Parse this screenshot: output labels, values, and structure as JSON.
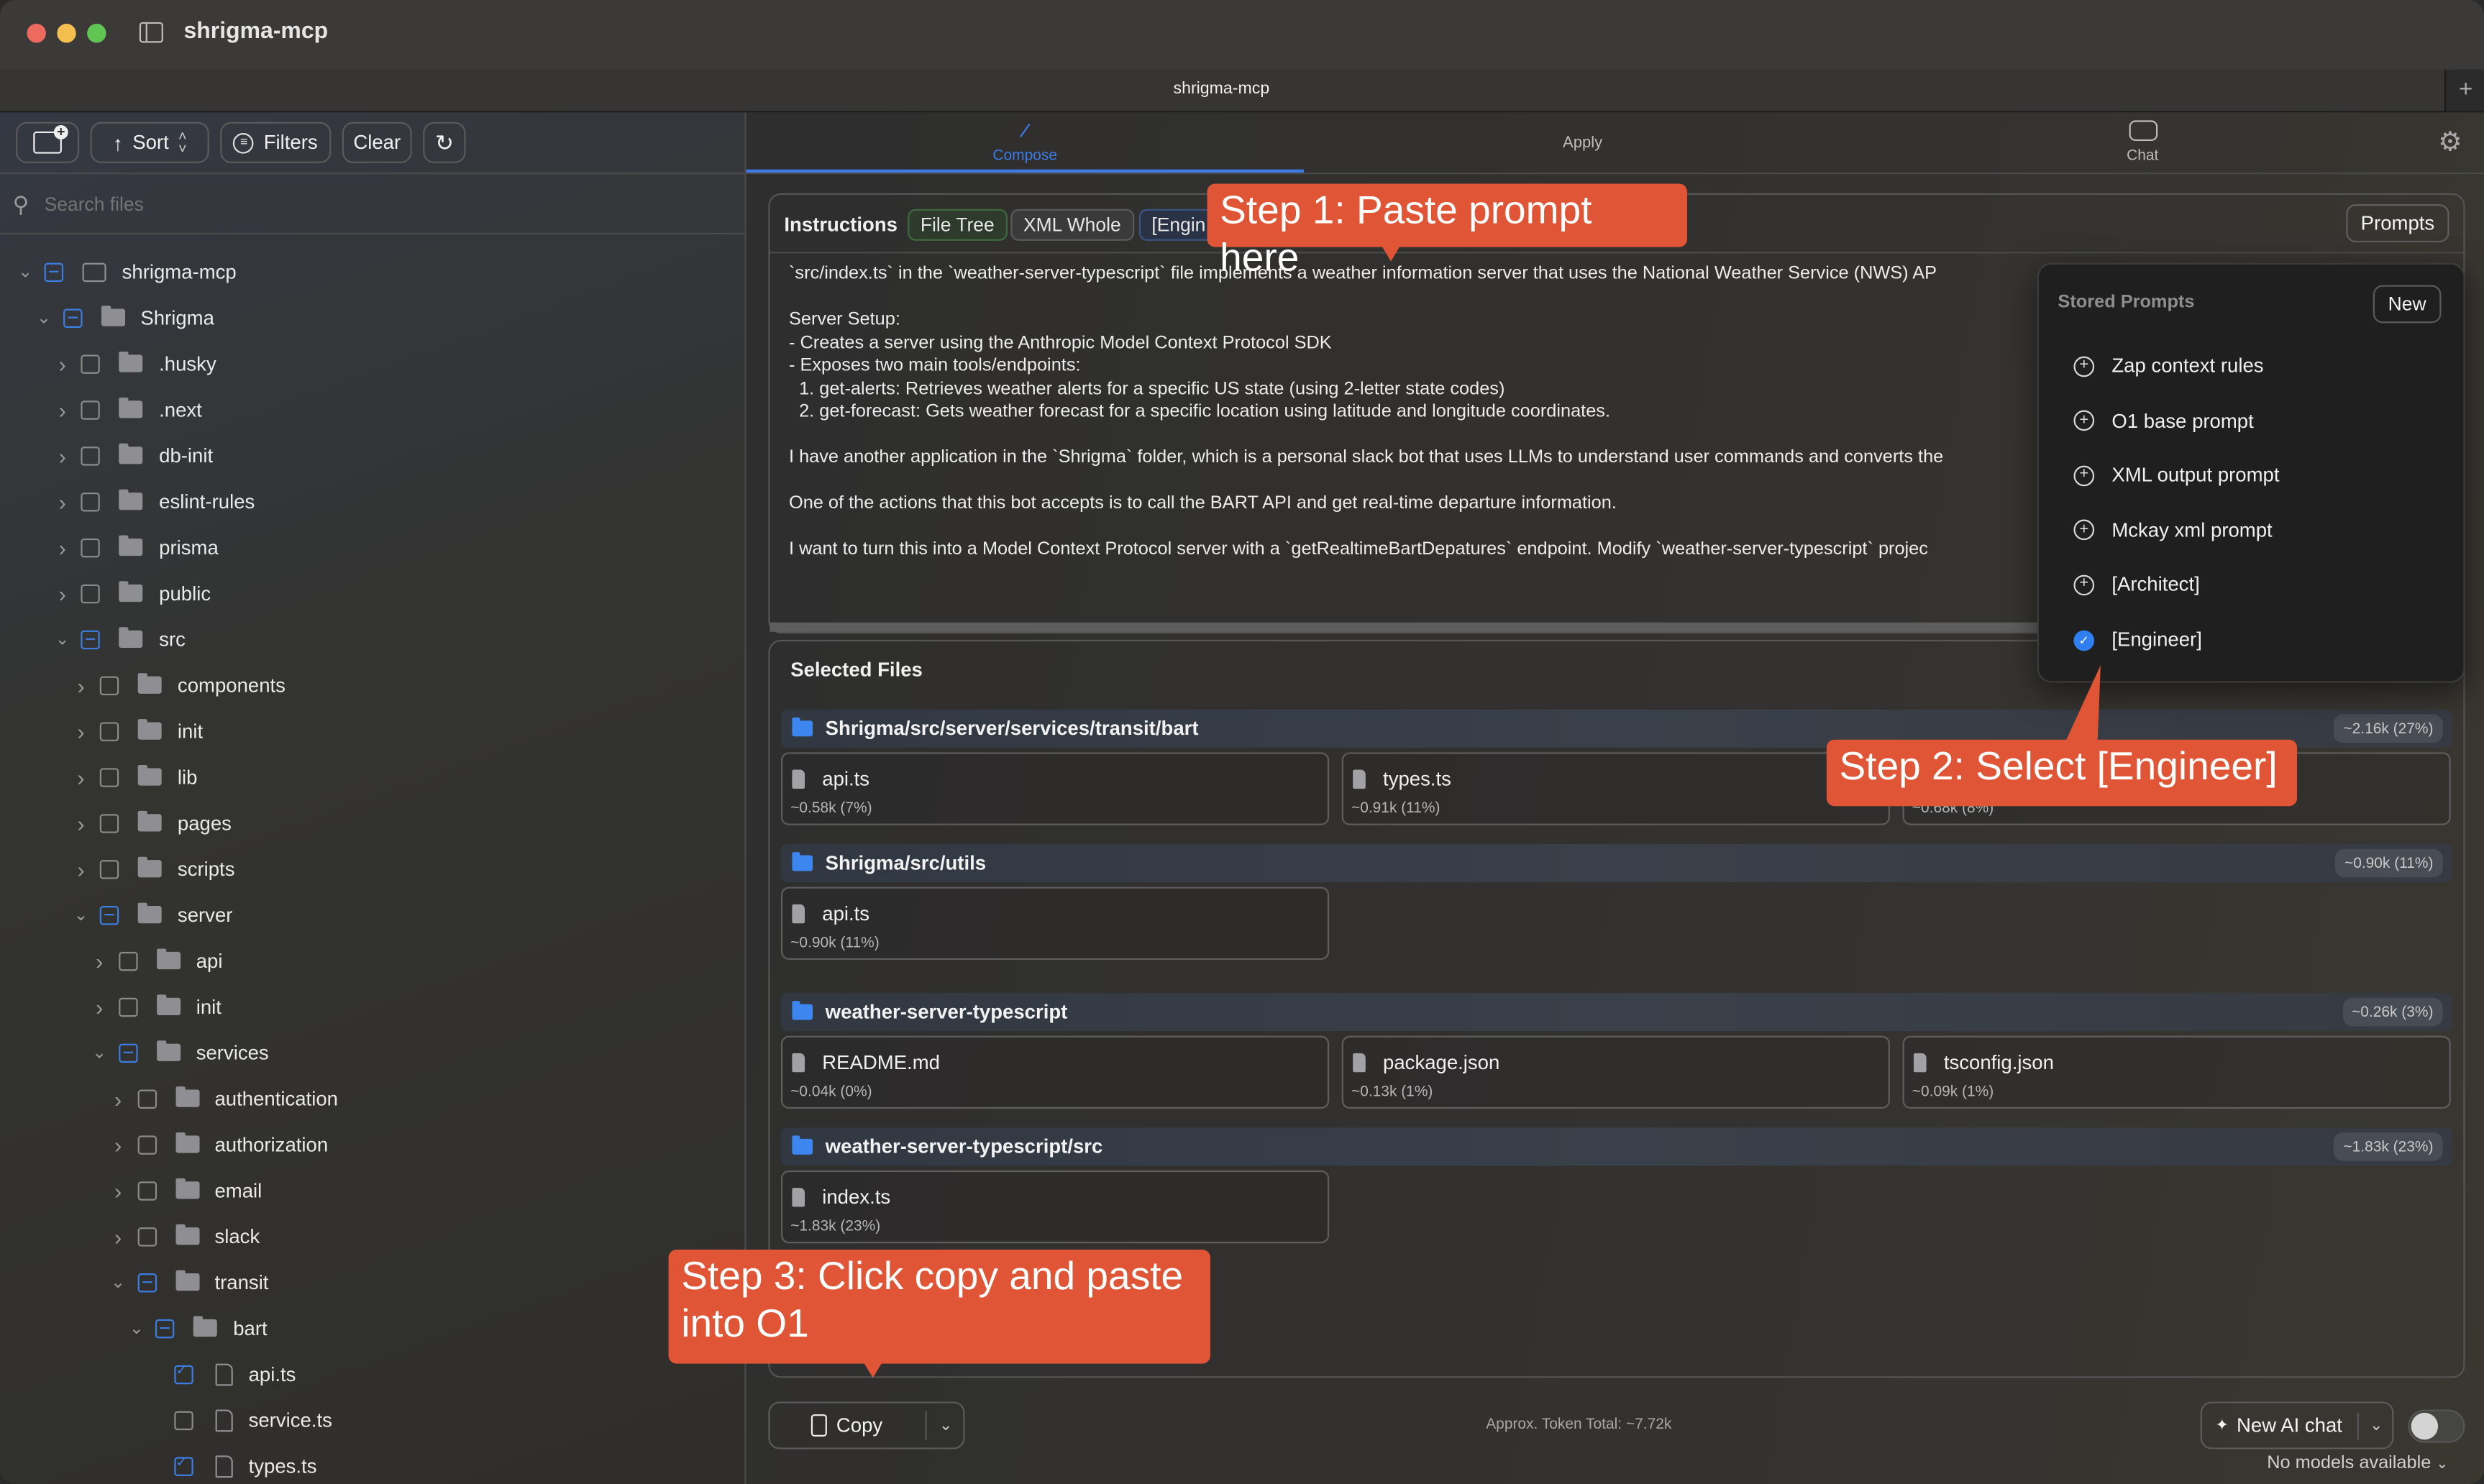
{
  "window": {
    "title": "shrigma-mcp",
    "tab_title": "shrigma-mcp",
    "new_tab_icon": "plus-icon",
    "traffic_lights": {
      "close": "#ed6a5e",
      "minimize": "#f5bf4f",
      "zoom": "#61c554"
    }
  },
  "sidebar": {
    "toolbar": {
      "add_folder_icon": "folder-plus-icon",
      "sort_label": "Sort",
      "filters_label": "Filters",
      "clear_label": "Clear",
      "refresh_icon": "refresh-icon"
    },
    "search": {
      "placeholder": "Search files",
      "value": ""
    },
    "tree": [
      {
        "label": "shrigma-mcp",
        "depth": 0,
        "expanded": true,
        "state": "partial",
        "type": "root-folder"
      },
      {
        "label": "Shrigma",
        "depth": 1,
        "expanded": true,
        "state": "partial",
        "type": "folder"
      },
      {
        "label": ".husky",
        "depth": 2,
        "expanded": false,
        "state": "unchecked",
        "type": "folder"
      },
      {
        "label": ".next",
        "depth": 2,
        "expanded": false,
        "state": "unchecked",
        "type": "folder"
      },
      {
        "label": "db-init",
        "depth": 2,
        "expanded": false,
        "state": "unchecked",
        "type": "folder"
      },
      {
        "label": "eslint-rules",
        "depth": 2,
        "expanded": false,
        "state": "unchecked",
        "type": "folder"
      },
      {
        "label": "prisma",
        "depth": 2,
        "expanded": false,
        "state": "unchecked",
        "type": "folder"
      },
      {
        "label": "public",
        "depth": 2,
        "expanded": false,
        "state": "unchecked",
        "type": "folder"
      },
      {
        "label": "src",
        "depth": 2,
        "expanded": true,
        "state": "partial",
        "type": "folder"
      },
      {
        "label": "components",
        "depth": 3,
        "expanded": false,
        "state": "unchecked",
        "type": "folder"
      },
      {
        "label": "init",
        "depth": 3,
        "expanded": false,
        "state": "unchecked",
        "type": "folder"
      },
      {
        "label": "lib",
        "depth": 3,
        "expanded": false,
        "state": "unchecked",
        "type": "folder"
      },
      {
        "label": "pages",
        "depth": 3,
        "expanded": false,
        "state": "unchecked",
        "type": "folder"
      },
      {
        "label": "scripts",
        "depth": 3,
        "expanded": false,
        "state": "unchecked",
        "type": "folder"
      },
      {
        "label": "server",
        "depth": 3,
        "expanded": true,
        "state": "partial",
        "type": "folder"
      },
      {
        "label": "api",
        "depth": 4,
        "expanded": false,
        "state": "unchecked",
        "type": "folder"
      },
      {
        "label": "init",
        "depth": 4,
        "expanded": false,
        "state": "unchecked",
        "type": "folder"
      },
      {
        "label": "services",
        "depth": 4,
        "expanded": true,
        "state": "partial",
        "type": "folder"
      },
      {
        "label": "authentication",
        "depth": 5,
        "expanded": false,
        "state": "unchecked",
        "type": "folder"
      },
      {
        "label": "authorization",
        "depth": 5,
        "expanded": false,
        "state": "unchecked",
        "type": "folder"
      },
      {
        "label": "email",
        "depth": 5,
        "expanded": false,
        "state": "unchecked",
        "type": "folder"
      },
      {
        "label": "slack",
        "depth": 5,
        "expanded": false,
        "state": "unchecked",
        "type": "folder"
      },
      {
        "label": "transit",
        "depth": 5,
        "expanded": true,
        "state": "partial",
        "type": "folder"
      },
      {
        "label": "bart",
        "depth": 6,
        "expanded": true,
        "state": "partial",
        "type": "folder"
      },
      {
        "label": "api.ts",
        "depth": 7,
        "state": "checked",
        "type": "file"
      },
      {
        "label": "service.ts",
        "depth": 7,
        "state": "unchecked",
        "type": "file"
      },
      {
        "label": "types.ts",
        "depth": 7,
        "state": "checked",
        "type": "file"
      }
    ]
  },
  "main": {
    "tabs": [
      {
        "label": "Compose",
        "icon": "pencil-icon",
        "active": true
      },
      {
        "label": "Apply",
        "icon": "",
        "active": false
      },
      {
        "label": "Chat",
        "icon": "chat-bubbles-icon",
        "active": false
      }
    ],
    "settings_icon": "gear-icon",
    "accent_color": "#3d7be6",
    "instructions": {
      "label": "Instructions",
      "chips": [
        "File Tree",
        "XML Whole",
        "[Engin"
      ],
      "prompts_button": "Prompts",
      "lines": [
        "`src/index.ts` in the `weather-server-typescript` file implements a weather information server that uses the National Weather Service (NWS) AP",
        "",
        "Server Setup:",
        "- Creates a server using the Anthropic Model Context Protocol SDK",
        "- Exposes two main tools/endpoints:",
        "  1. get-alerts: Retrieves weather alerts for a specific US state (using 2-letter state codes)",
        "  2. get-forecast: Gets weather forecast for a specific location using latitude and longitude coordinates.",
        "",
        "I have another application in the `Shrigma` folder, which is a personal slack bot that uses LLMs to understand user commands and converts the",
        "",
        "One of the actions that this bot accepts is to call the BART API and get real-time departure information.",
        "",
        "I want to turn this into a Model Context Protocol server with a `getRealtimeBartDepatures` endpoint. Modify `weather-server-typescript` projec"
      ]
    },
    "stored_prompts": {
      "title": "Stored Prompts",
      "new_button": "New",
      "items": [
        {
          "label": "Zap context rules",
          "selected": false
        },
        {
          "label": "O1 base prompt",
          "selected": false
        },
        {
          "label": "XML output prompt",
          "selected": false
        },
        {
          "label": "Mckay xml prompt",
          "selected": false
        },
        {
          "label": "[Architect]",
          "selected": false
        },
        {
          "label": "[Engineer]",
          "selected": true
        }
      ]
    },
    "selected_files": {
      "title": "Selected Files",
      "groups": [
        {
          "path": "Shrigma/src/server/services/transit/bart",
          "tokens": "~2.16k (27%)",
          "files": [
            {
              "name": "api.ts",
              "tokens": "~0.58k (7%)"
            },
            {
              "name": "types.ts",
              "tokens": "~0.91k (11%)"
            },
            {
              "name": "",
              "tokens": "~0.68k (8%)"
            }
          ]
        },
        {
          "path": "Shrigma/src/utils",
          "tokens": "~0.90k (11%)",
          "files": [
            {
              "name": "api.ts",
              "tokens": "~0.90k (11%)"
            }
          ]
        },
        {
          "path": "weather-server-typescript",
          "tokens": "~0.26k (3%)",
          "files": [
            {
              "name": "README.md",
              "tokens": "~0.04k (0%)"
            },
            {
              "name": "package.json",
              "tokens": "~0.13k (1%)"
            },
            {
              "name": "tsconfig.json",
              "tokens": "~0.09k (1%)"
            }
          ]
        },
        {
          "path": "weather-server-typescript/src",
          "tokens": "~1.83k (23%)",
          "files": [
            {
              "name": "index.ts",
              "tokens": "~1.83k (23%)"
            }
          ]
        }
      ]
    },
    "footer": {
      "copy_label": "Copy",
      "token_total": "Approx. Token Total: ~7.72k",
      "new_chat_label": "New AI chat",
      "toggle_on": false,
      "models_label": "No models available"
    }
  },
  "annotations": {
    "color": "#e05535",
    "step1": "Step 1: Paste prompt here",
    "step2": "Step 2: Select [Engineer]",
    "step3_line1": "Step 3: Click copy and paste",
    "step3_line2": "into O1"
  }
}
